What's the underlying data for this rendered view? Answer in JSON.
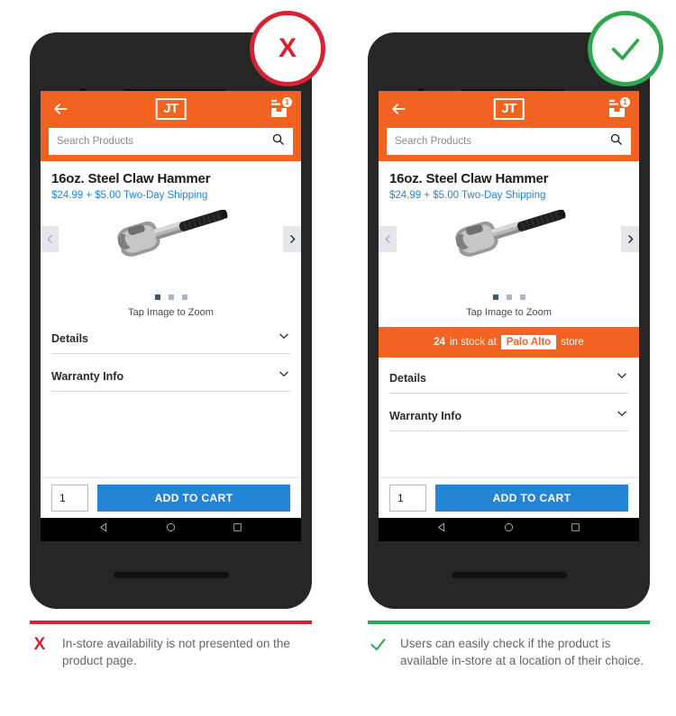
{
  "comparison": {
    "bad": {
      "badge_icon": "x-circle-icon",
      "badge_symbol": "X",
      "caption_symbol": "X",
      "caption": "In-store availability is not presented on the product page.",
      "accent_color": "#d92231"
    },
    "good": {
      "badge_icon": "check-circle-icon",
      "caption_icon": "check-icon",
      "caption": "Users can easily check if the product is available in-store at a location of their choice.",
      "accent_color": "#2ea84f"
    }
  },
  "app": {
    "brand_color": "#f26322",
    "link_color": "#2484d6",
    "appbar": {
      "back_icon": "back-arrow-icon",
      "logo_text": "JT",
      "cart_icon": "shopping-cart-icon",
      "cart_count": "1"
    },
    "search": {
      "icon": "search-icon",
      "placeholder": "Search Products",
      "value": ""
    },
    "product": {
      "title": "16oz. Steel Claw Hammer",
      "price_line": "$24.99 + $5.00 Two-Day Shipping",
      "image_alt": "claw-hammer-photo",
      "prev_icon": "chevron-left-icon",
      "next_icon": "chevron-right-icon",
      "dots_total": 3,
      "dots_active_index": 0,
      "zoom_hint": "Tap Image to Zoom"
    },
    "stock_banner": {
      "quantity": "24",
      "text_before": "in stock at",
      "store_name": "Palo Alto",
      "text_after": "store"
    },
    "accordions": [
      {
        "label": "Details",
        "chevron": "chevron-down-icon"
      },
      {
        "label": "Warranty Info",
        "chevron": "chevron-down-icon"
      }
    ],
    "cart_bar": {
      "quantity_value": "1",
      "add_to_cart_label": "ADD TO CART"
    },
    "navbar": {
      "back_icon": "android-back-icon",
      "home_icon": "android-home-icon",
      "recents_icon": "android-recents-icon"
    }
  }
}
